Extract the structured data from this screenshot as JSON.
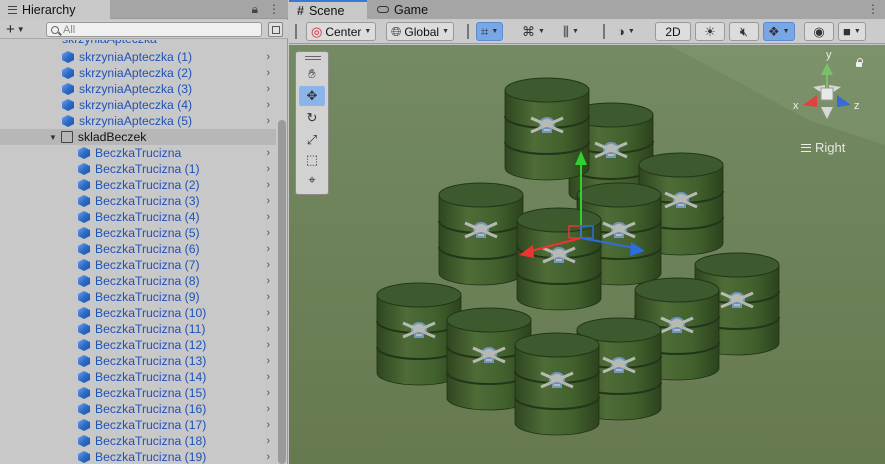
{
  "hierarchy": {
    "tab_title": "Hierarchy",
    "add_label": "+",
    "search_placeholder": "All",
    "cut_row": "skrzyniaApteczka",
    "apteczka_items": [
      "skrzyniaApteczka (1)",
      "skrzyniaApteczka (2)",
      "skrzyniaApteczka (3)",
      "skrzyniaApteczka (4)",
      "skrzyniaApteczka (5)"
    ],
    "parent": "skladBeczek",
    "barrels": [
      "BeczkaTrucizna",
      "BeczkaTrucizna (1)",
      "BeczkaTrucizna (2)",
      "BeczkaTrucizna (3)",
      "BeczkaTrucizna (4)",
      "BeczkaTrucizna (5)",
      "BeczkaTrucizna (6)",
      "BeczkaTrucizna (7)",
      "BeczkaTrucizna (8)",
      "BeczkaTrucizna (9)",
      "BeczkaTrucizna (10)",
      "BeczkaTrucizna (11)",
      "BeczkaTrucizna (12)",
      "BeczkaTrucizna (13)",
      "BeczkaTrucizna (14)",
      "BeczkaTrucizna (15)",
      "BeczkaTrucizna (16)",
      "BeczkaTrucizna (17)",
      "BeczkaTrucizna (18)",
      "BeczkaTrucizna (19)"
    ]
  },
  "scene": {
    "tab_scene": "Scene",
    "tab_game": "Game",
    "pivot_label": "Center",
    "space_label": "Global",
    "mode_2d": "2D",
    "view_label": "Right",
    "axis_x": "x",
    "axis_y": "y",
    "axis_z": "z"
  },
  "colors": {
    "accent": "#3a79d6",
    "link_blue": "#1f53b8",
    "scene_background": "#6c825a",
    "barrel_green": "#3f5a2c"
  }
}
